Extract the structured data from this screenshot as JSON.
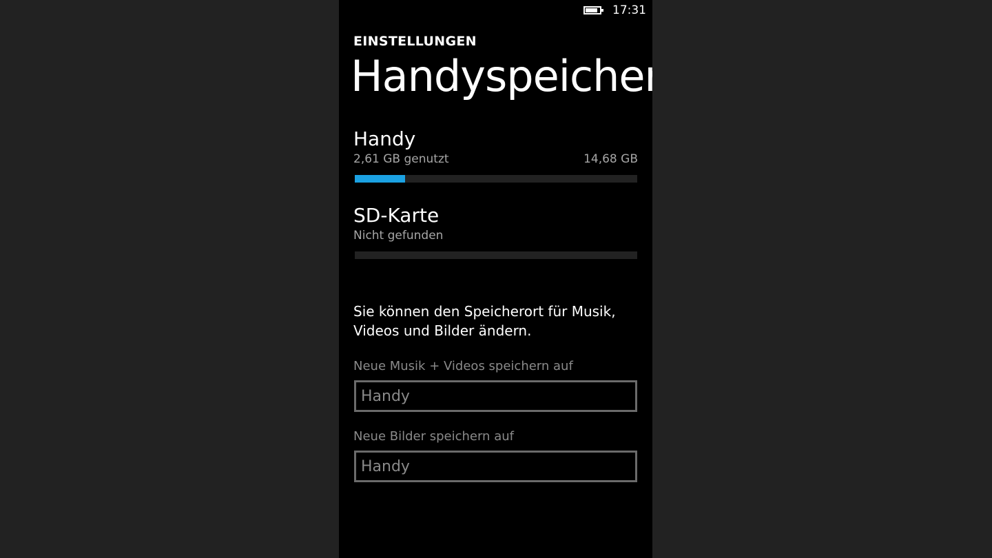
{
  "status_bar": {
    "time": "17:31",
    "battery_level": 0.85
  },
  "header": {
    "app_title": "EINSTELLUNGEN",
    "page_title": "Handyspeicher"
  },
  "storage": [
    {
      "name": "Handy",
      "status": "2,61 GB genutzt",
      "capacity": "14,68 GB",
      "used_fraction": 0.178
    },
    {
      "name": "SD-Karte",
      "status": "Nicht gefunden",
      "capacity": "",
      "used_fraction": 0
    }
  ],
  "info_text": "Sie können den Speicherort für Musik, Videos und Bilder ändern.",
  "pickers": [
    {
      "label": "Neue Musik + Videos speichern auf",
      "value": "Handy"
    },
    {
      "label": "Neue Bilder speichern auf",
      "value": "Handy"
    }
  ],
  "colors": {
    "accent": "#1ba1e2",
    "background": "#000000",
    "secondary_text": "#a6a6a6",
    "disabled_text": "#8a8a8a"
  }
}
